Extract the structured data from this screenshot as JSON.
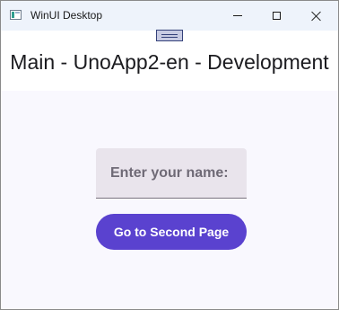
{
  "window": {
    "title": "WinUI Desktop",
    "icon": "app-window-icon",
    "controls": {
      "minimize_icon": "minimize-icon",
      "maximize_icon": "maximize-icon",
      "close_icon": "close-icon"
    }
  },
  "header": {
    "title": "Main - UnoApp2-en - Development"
  },
  "form": {
    "name_placeholder": "Enter your name:",
    "name_value": ""
  },
  "actions": {
    "second_page_label": "Go to Second Page"
  },
  "colors": {
    "accent": "#5a42cf",
    "page_background": "#f9f8fe",
    "input_background": "#e9e4ec"
  }
}
